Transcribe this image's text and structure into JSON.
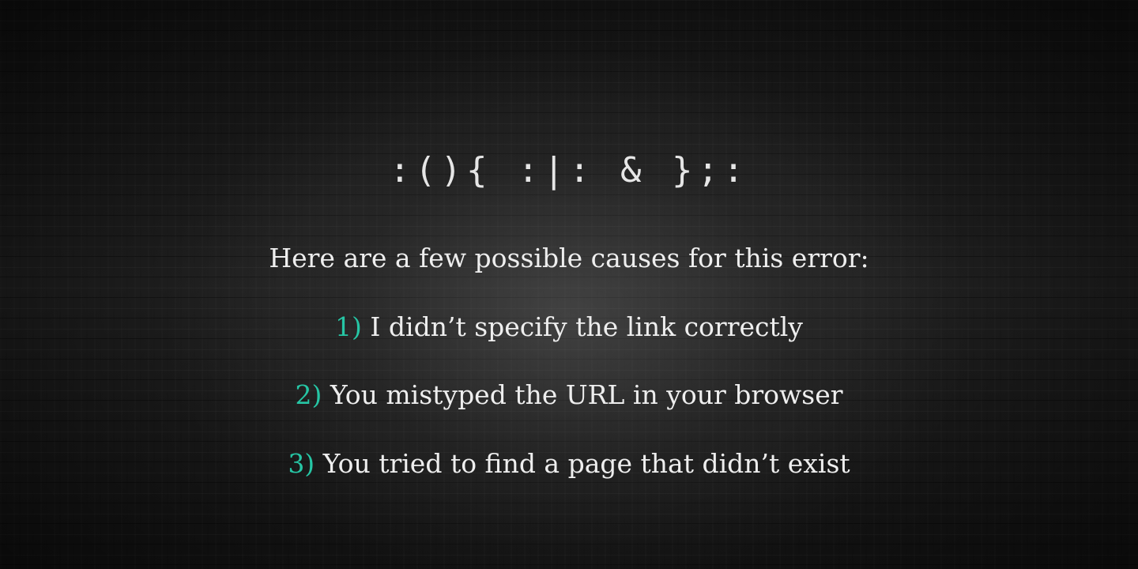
{
  "fork_bomb": ":(){ :|: & };:",
  "heading": "Here are a few possible causes for this error:",
  "causes": [
    {
      "number": "1)",
      "text": " I didn’t specify the link correctly"
    },
    {
      "number": "2)",
      "text": " You mistyped the URL in your browser"
    },
    {
      "number": "3)",
      "text": " You tried to find a page that didn’t exist"
    }
  ],
  "colors": {
    "accent": "#26c6a5",
    "text": "#eeeeee",
    "background": "#1b1b1b"
  }
}
